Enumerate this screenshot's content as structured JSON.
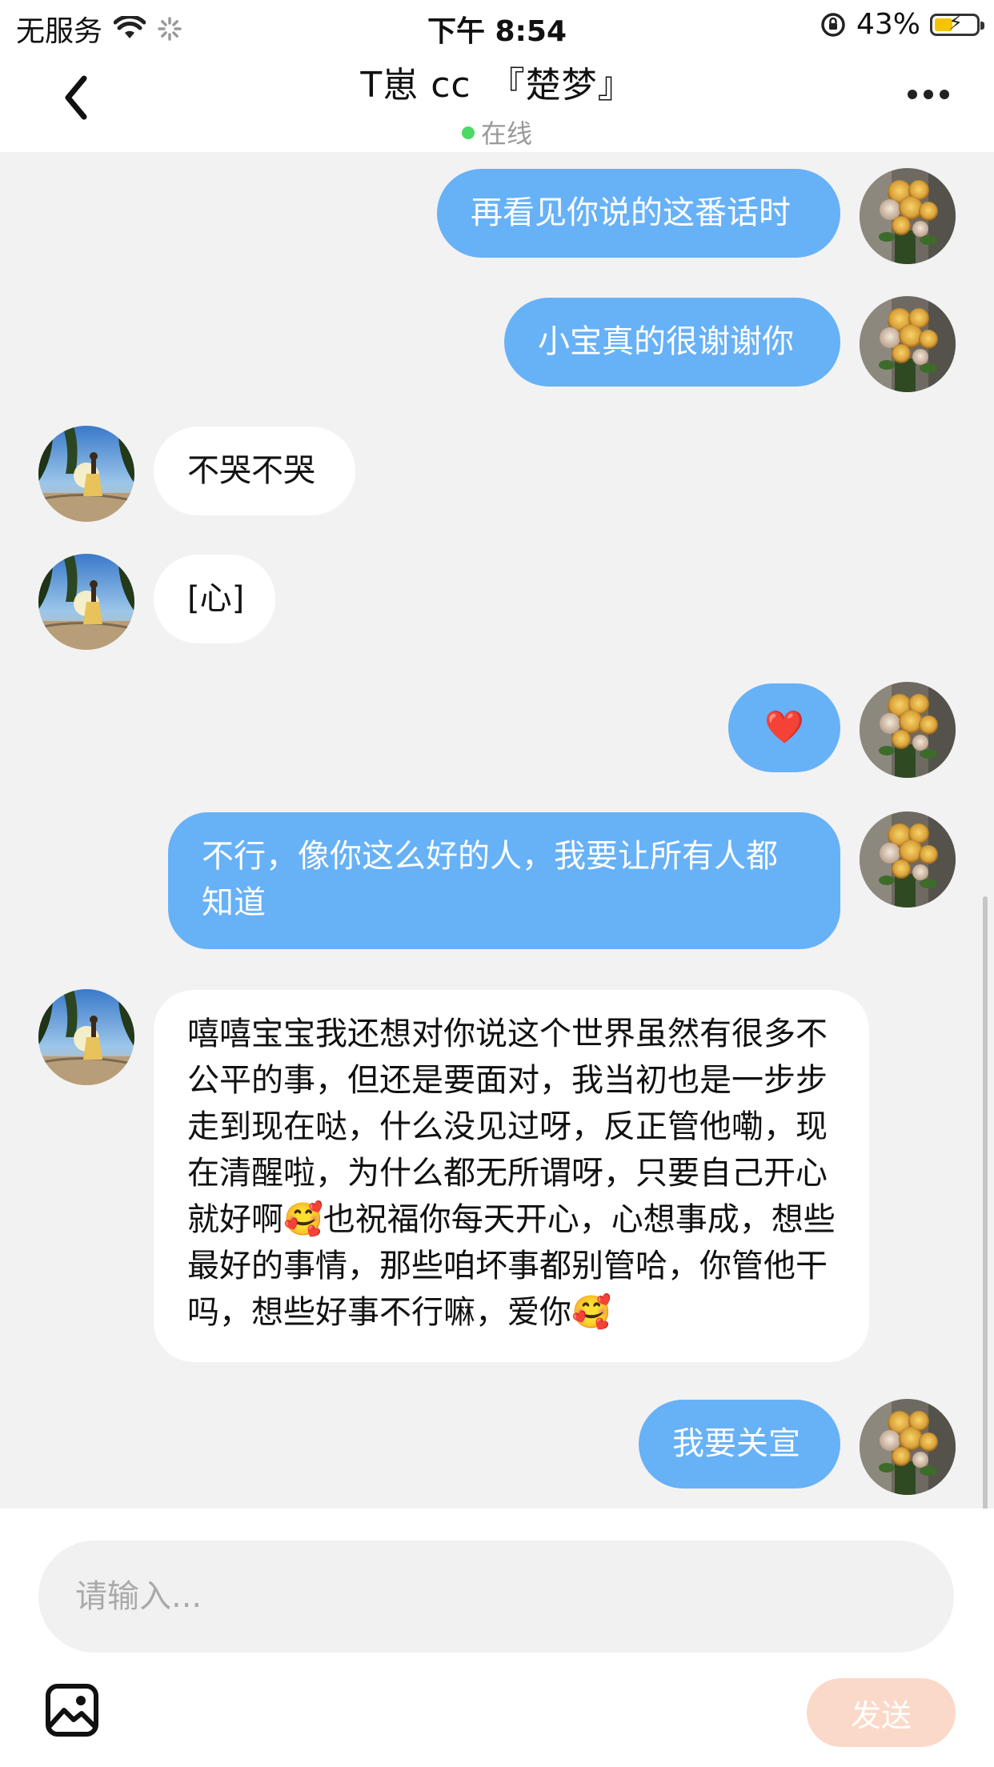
{
  "status_bar": {
    "carrier": "无服务",
    "time": "下午 8:54",
    "battery": "43%",
    "battery_level": 0.43
  },
  "header": {
    "title": "T崽 cc　『楚梦』",
    "status": "在线",
    "back_icon": "chevron-left-icon",
    "more_icon": "more-dots-icon"
  },
  "messages": [
    {
      "side": "out",
      "text": "再看见你说的这番话时"
    },
    {
      "side": "out",
      "text": "小宝真的很谢谢你"
    },
    {
      "side": "in",
      "text": "不哭不哭"
    },
    {
      "side": "in",
      "text": "[心]"
    },
    {
      "side": "out",
      "text": "❤️"
    },
    {
      "side": "out",
      "text": "不行，像你这么好的人，我要让所有人都知道"
    },
    {
      "side": "in",
      "text": "嘻嘻宝宝我还想对你说这个世界虽然有很多不公平的事，但还是要面对，我当初也是一步步走到现在哒，什么没见过呀，反正管他嘞，现在清醒啦，为什么都无所谓呀，只要自己开心就好啊🥰也祝福你每天开心，心想事成，想些最好的事情，那些咱坏事都别管哈，你管他干吗，想些好事不行嘛，爱你🥰"
    },
    {
      "side": "out",
      "text": "我要关宣"
    }
  ],
  "composer": {
    "placeholder": "请输入...",
    "send_label": "发送",
    "image_icon": "image-icon"
  },
  "colors": {
    "outgoing_bubble": "#67b1f7",
    "incoming_bubble": "#ffffff",
    "chat_background": "#f2f2f3",
    "online_dot": "#4cd964",
    "send_button": "#fbd9c8"
  }
}
